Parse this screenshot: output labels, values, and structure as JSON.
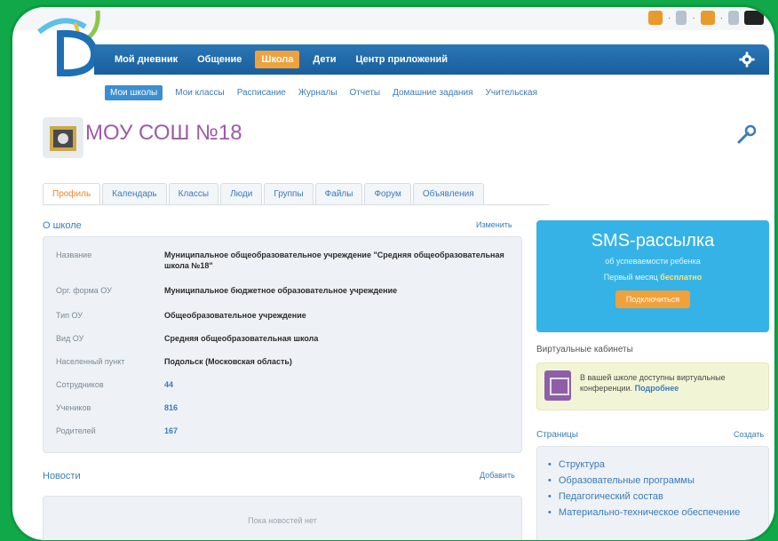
{
  "main_nav": {
    "items": [
      {
        "label": "Мой дневник"
      },
      {
        "label": "Общение"
      },
      {
        "label": "Школа"
      },
      {
        "label": "Дети"
      },
      {
        "label": "Центр приложений"
      }
    ],
    "active_index": 2
  },
  "sub_nav": {
    "items": [
      {
        "label": "Мои школы"
      },
      {
        "label": "Мои классы"
      },
      {
        "label": "Расписание"
      },
      {
        "label": "Журналы"
      },
      {
        "label": "Отчеты"
      },
      {
        "label": "Домашние задания"
      },
      {
        "label": "Учительская"
      }
    ],
    "active_index": 0
  },
  "school": {
    "title": "МОУ СОШ №18"
  },
  "tabs": {
    "items": [
      {
        "label": "Профиль"
      },
      {
        "label": "Календарь"
      },
      {
        "label": "Классы"
      },
      {
        "label": "Люди"
      },
      {
        "label": "Группы"
      },
      {
        "label": "Файлы"
      },
      {
        "label": "Форум"
      },
      {
        "label": "Объявления"
      }
    ],
    "active_index": 0
  },
  "about": {
    "heading": "О школе",
    "action": "Изменить",
    "rows": [
      {
        "label": "Название",
        "value": "Муниципальное общеобразовательное учреждение \"Средняя общеобразовательная школа №18\""
      },
      {
        "label": "Орг. форма ОУ",
        "value": "Муниципальное бюджетное образовательное учреждение"
      },
      {
        "label": "Тип ОУ",
        "value": "Общеобразовательное учреждение"
      },
      {
        "label": "Вид ОУ",
        "value": "Средняя общеобразовательная школа"
      },
      {
        "label": "Населенный пункт",
        "value": "Подольск (Московская область)"
      },
      {
        "label": "Сотрудников",
        "value": "44"
      },
      {
        "label": "Учеников",
        "value": "816"
      },
      {
        "label": "Родителей",
        "value": "167"
      }
    ]
  },
  "news": {
    "heading": "Новости",
    "action": "Добавить",
    "empty": "Пока новостей нет"
  },
  "sms": {
    "title": "SMS-рассылка",
    "subtitle": "об успеваемости ребенка",
    "line_prefix": "Первый месяц",
    "line_free": "бесплатно",
    "button": "Подключиться"
  },
  "virtual": {
    "heading": "Виртуальные кабинеты",
    "text": "В вашей школе доступны виртуальные конференции.",
    "more": "Подробнее"
  },
  "pages": {
    "heading": "Страницы",
    "action": "Создать",
    "items": [
      {
        "label": "Структура"
      },
      {
        "label": "Образовательные программы"
      },
      {
        "label": "Педагогический состав"
      },
      {
        "label": "Материально-техническое обеспечение"
      }
    ]
  },
  "colors": {
    "frame_green": "#10a848",
    "nav_blue": "#1a5f9d",
    "accent_orange": "#f0a13a",
    "title_purple": "#9c5ca6",
    "sms_blue": "#35b3e6"
  }
}
